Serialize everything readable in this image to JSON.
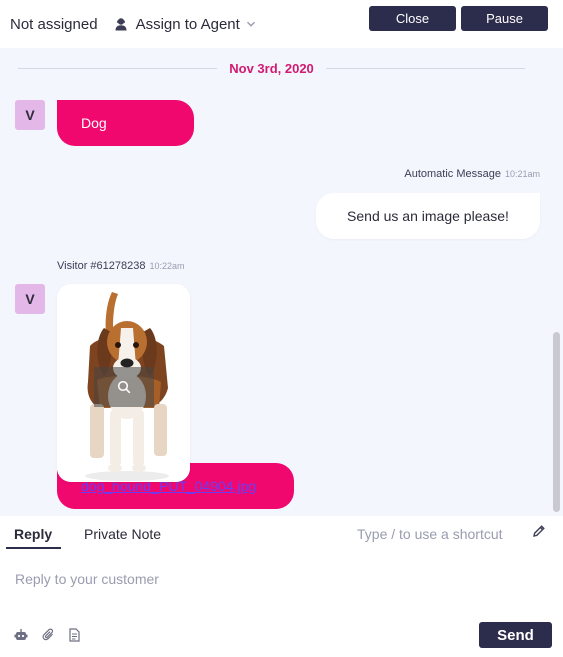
{
  "header": {
    "status": "Not assigned",
    "assign_label": "Assign to Agent",
    "close_label": "Close",
    "pause_label": "Pause"
  },
  "conversation": {
    "date": "Nov 3rd, 2020",
    "messages": [
      {
        "avatar": "V",
        "text": "Dog"
      },
      {
        "sender": "Automatic Message",
        "time": "10:21am",
        "text": "Send us an image please!"
      },
      {
        "sender": "Visitor #61278238",
        "time": "10:22am",
        "avatar": "V",
        "attachment": "dog_hound_PUT_04904.jpg"
      }
    ]
  },
  "composer": {
    "tabs": [
      "Reply",
      "Private Note"
    ],
    "active_tab": "Reply",
    "shortcut_hint": "Type / to use a shortcut",
    "placeholder": "Reply to your customer",
    "send_label": "Send"
  },
  "colors": {
    "accent_pink": "#f0086f",
    "date_pink": "#d11a71",
    "dark_button": "#2c2c4c",
    "avatar_bg": "#e3b8e8",
    "conv_bg": "#f4f6fd"
  },
  "icons": [
    "agent-icon",
    "chevron-down-icon",
    "search-icon",
    "pencil-icon",
    "bot-icon",
    "paperclip-icon",
    "document-icon"
  ]
}
